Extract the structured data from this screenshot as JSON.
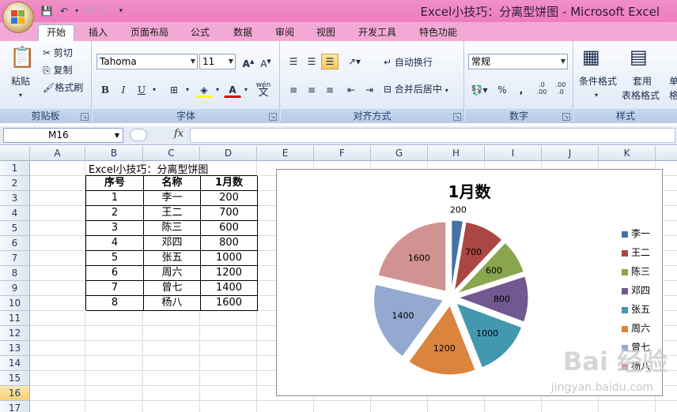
{
  "window": {
    "title": "Excel小技巧：分离型饼图 - Microsoft Excel"
  },
  "tabs": [
    "开始",
    "插入",
    "页面布局",
    "公式",
    "数据",
    "审阅",
    "视图",
    "开发工具",
    "特色功能"
  ],
  "ribbon": {
    "clipboard": {
      "paste": "粘贴",
      "cut": "剪切",
      "copy": "复制",
      "format_painter": "格式刷",
      "label": "剪贴板"
    },
    "font": {
      "name": "Tahoma",
      "size": "11",
      "bold": "B",
      "italic": "I",
      "underline": "U",
      "label": "字体",
      "wen": "wén",
      "wen_char": "文"
    },
    "alignment": {
      "wrap": "自动换行",
      "merge": "合并后居中",
      "label": "对齐方式"
    },
    "number": {
      "format": "常规",
      "percent": "%",
      "comma": ",",
      "label": "数字",
      "inc_decimal": ".0\n.00",
      "dec_decimal": ".00\n.0"
    },
    "styles": {
      "conditional": "条件格式",
      "table": "套用",
      "table2": "表格格式",
      "cell_style_partial": "单",
      "cell_style_partial2": "格",
      "label": "样式"
    }
  },
  "formula_bar": {
    "name_box": "M16",
    "fx": "fx",
    "content": ""
  },
  "grid": {
    "columns": [
      "A",
      "B",
      "C",
      "D",
      "E",
      "F",
      "G",
      "H",
      "I",
      "J",
      "K"
    ],
    "rows": [
      "1",
      "2",
      "3",
      "4",
      "5",
      "6",
      "7",
      "8",
      "9",
      "10",
      "11",
      "12",
      "13",
      "14",
      "15",
      "16",
      "17"
    ],
    "selected_row": "16"
  },
  "sheet": {
    "title": "Excel小技巧：分离型饼图",
    "headers": [
      "序号",
      "名称",
      "1月数"
    ],
    "rows": [
      [
        "1",
        "李一",
        "200"
      ],
      [
        "2",
        "王二",
        "700"
      ],
      [
        "3",
        "陈三",
        "600"
      ],
      [
        "4",
        "邓四",
        "800"
      ],
      [
        "5",
        "张五",
        "1000"
      ],
      [
        "6",
        "周六",
        "1200"
      ],
      [
        "7",
        "曾七",
        "1400"
      ],
      [
        "8",
        "杨八",
        "1600"
      ]
    ]
  },
  "chart_data": {
    "type": "pie",
    "title": "1月数",
    "categories": [
      "李一",
      "王二",
      "陈三",
      "邓四",
      "张五",
      "周六",
      "曾七",
      "杨八"
    ],
    "values": [
      200,
      700,
      600,
      800,
      1000,
      1200,
      1400,
      1600
    ],
    "colors": [
      "#4572a7",
      "#aa4643",
      "#89a54e",
      "#71588f",
      "#4198af",
      "#db843d",
      "#93a9cf",
      "#d19392"
    ],
    "exploded": true,
    "legend": "right",
    "data_labels": true
  },
  "watermark": {
    "text": "Bai 经验",
    "url": "jingyan.baidu.com"
  }
}
